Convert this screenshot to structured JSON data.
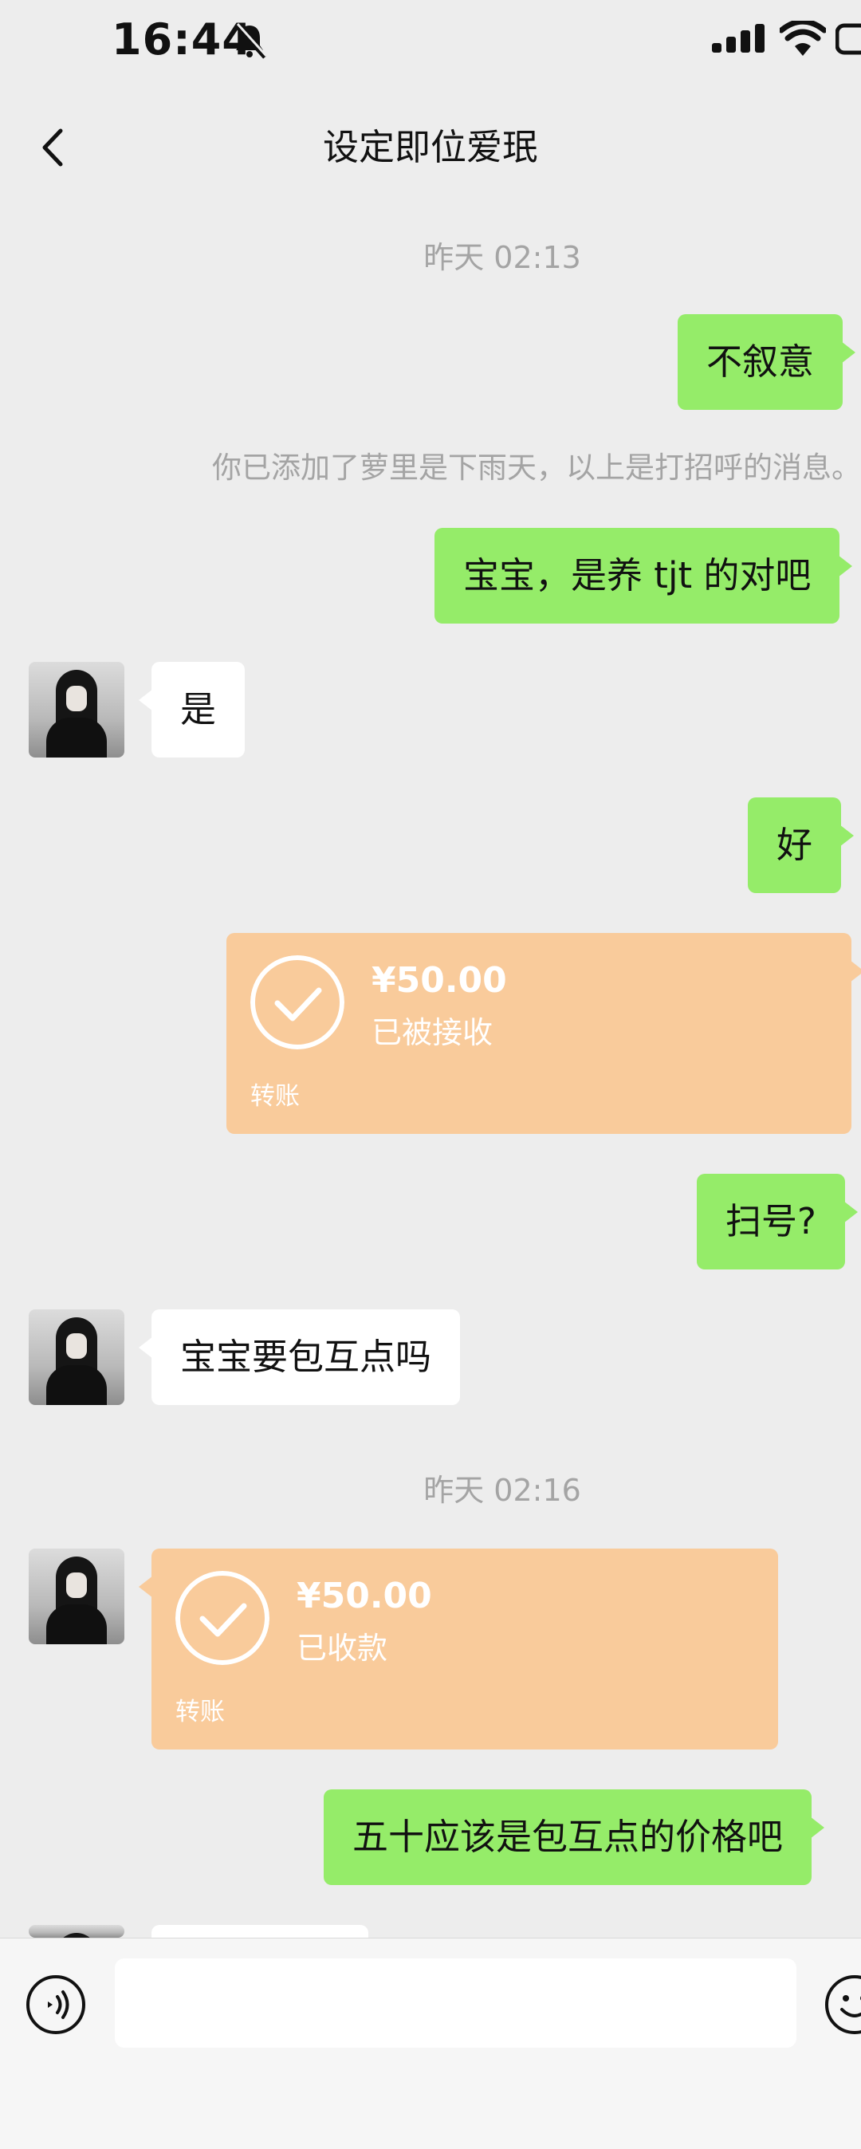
{
  "status_bar": {
    "time": "16:44"
  },
  "header": {
    "title": "设定即位爱珉"
  },
  "messages": {
    "ts1": "昨天 02:13",
    "m1": "不叙意",
    "sys1": "你已添加了萝里是下雨天，以上是打招呼的消息。",
    "m2": "宝宝，是养 tjt 的对吧",
    "m3": "是",
    "m4": "好",
    "m5": "扫号?",
    "m6": "宝宝要包互点吗",
    "ts2": "昨天 02:16",
    "m7": "五十应该是包互点的价格吧"
  },
  "transfers": {
    "t1": {
      "amount": "¥50.00",
      "status": "已被接收",
      "label": "转账"
    },
    "t2": {
      "amount": "¥50.00",
      "status": "已收款",
      "label": "转账"
    }
  },
  "colors": {
    "my_bubble": "#95ec69",
    "transfer": "#f9cb9b",
    "background": "#ededed"
  },
  "icons": [
    "bell-off-icon",
    "signal-icon",
    "wifi-icon",
    "battery-icon",
    "back-arrow-icon",
    "voice-icon",
    "emoji-icon"
  ]
}
